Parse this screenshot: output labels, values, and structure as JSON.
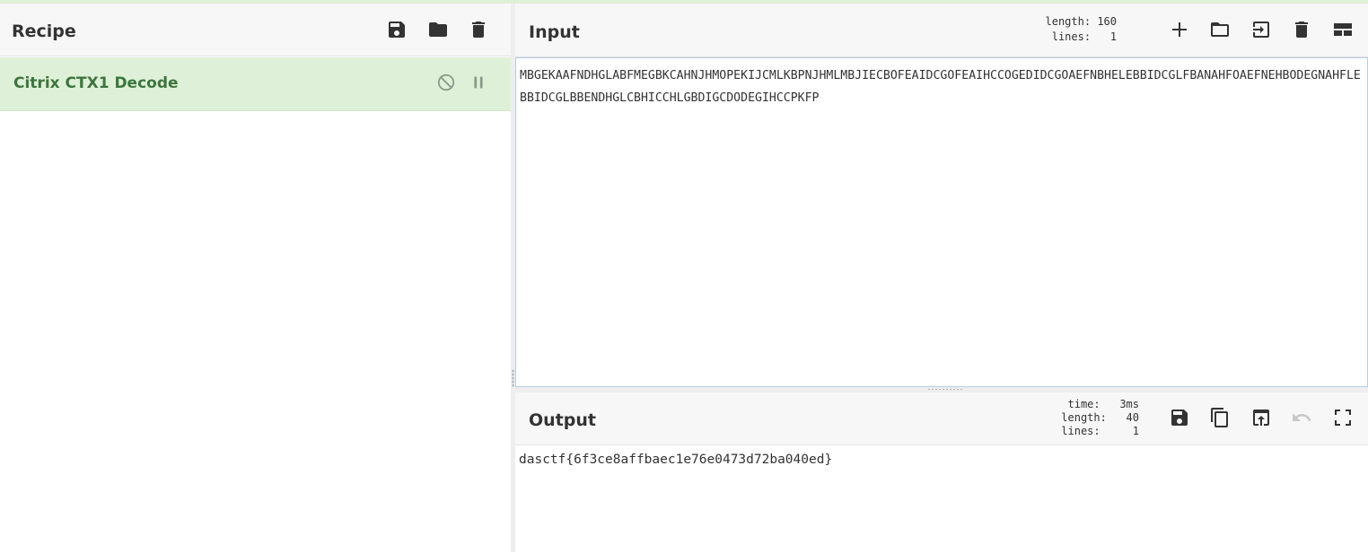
{
  "recipe": {
    "title": "Recipe",
    "operations": [
      {
        "name": "Citrix CTX1 Decode"
      }
    ]
  },
  "input": {
    "title": "Input",
    "length_label": "length:",
    "length_value": "160",
    "lines_label": "lines:",
    "lines_value": "1",
    "text": "MBGEKAAFNDHGLABFMEGBKCAHNJHMOPEKIJCMLKBPNJHMLMBJIECBOFEAIDCGOFEAIHCCOGEDIDCGOAEFNBHELEBBIDCGLFBANAHFOAEFNEHBODEGNAHFLEBBIDCGLBBENDHGLCBHICCHLGBDIGCDODEGIHCCPKFP"
  },
  "output": {
    "title": "Output",
    "time_label": "time:",
    "time_value": "3ms",
    "length_label": "length:",
    "length_value": "40",
    "lines_label": "lines:",
    "lines_value": "1",
    "text": "dasctf{6f3ce8affbaec1e76e0473d72ba040ed}"
  },
  "icons": {
    "save": "save-icon",
    "open": "folder-icon",
    "clear": "trash-icon",
    "add": "plus-icon",
    "disable": "disable-icon",
    "breakpoint": "pause-icon",
    "copy": "copy-icon",
    "replace_input": "move-to-input-icon",
    "undo": "undo-icon",
    "maximise": "maximise-icon",
    "layout": "layout-icon"
  },
  "colors": {
    "operation_bg": "#dff0d8",
    "operation_text": "#3c763d",
    "header_bg": "#f7f7f7",
    "input_border": "#b7cde6"
  }
}
